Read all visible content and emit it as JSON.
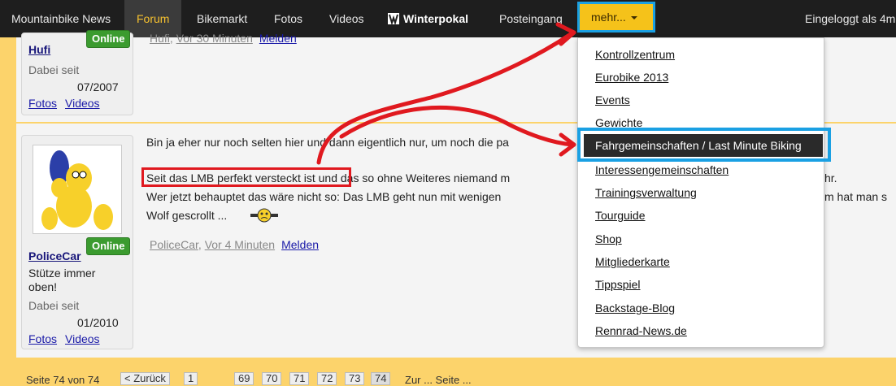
{
  "nav": {
    "items": [
      "Mountainbike News",
      "Forum",
      "Bikemarkt",
      "Fotos",
      "Videos",
      "Winterpokal",
      "Posteingang"
    ],
    "more_label": "mehr...",
    "logged_in": "Eingeloggt als 4m"
  },
  "post_prev": {
    "username": "Hufi",
    "member_since_label": "Dabei seit",
    "member_since": "07/2007",
    "links": [
      "Fotos",
      "Videos"
    ],
    "online": "Online",
    "meta_user": "Hufi",
    "meta_time": "Vor 30 Minuten",
    "report": "Melden"
  },
  "post_main": {
    "username": "PoliceCar",
    "title_line1": "Stütze immer",
    "title_line2": "oben!",
    "member_since_label": "Dabei seit",
    "member_since": "01/2010",
    "links": [
      "Fotos",
      "Videos"
    ],
    "online": "Online",
    "text": [
      "Bin ja eher nur noch selten hier und dann eigentlich nur, um noch die pa",
      "Seit das LMB perfekt versteckt ist und das so ohne Weiteres niemand m",
      "hr.",
      "Wer jetzt behauptet das wäre nicht so: Das LMB geht nun mit wenigen",
      "m hat man s",
      "Wolf gescrollt ..."
    ],
    "meta_user": "PoliceCar",
    "meta_time": "Vor 4 Minuten",
    "report": "Melden"
  },
  "dropdown": {
    "items": [
      "Kontrollzentrum",
      "Eurobike 2013",
      "Events",
      "Gewichte",
      "Fahrgemeinschaften / Last Minute Biking",
      "Interessengemeinschaften",
      "Trainingsverwaltung",
      "Tourguide",
      "Shop",
      "Mitgliederkarte",
      "Tippspiel",
      "Backstage-Blog",
      "Rennrad-News.de"
    ]
  },
  "pager": {
    "label": "Seite 74 von 74",
    "back": "< Zurück",
    "first": "1",
    "pages": [
      "69",
      "70",
      "71",
      "72",
      "73",
      "74"
    ],
    "tail": "Zur ... Seite ..."
  },
  "colors": {
    "accent": "#f5c21a",
    "highlight_border": "#1aa0e3",
    "annotation_red": "#e0191f",
    "online_green": "#3b9b2f"
  }
}
